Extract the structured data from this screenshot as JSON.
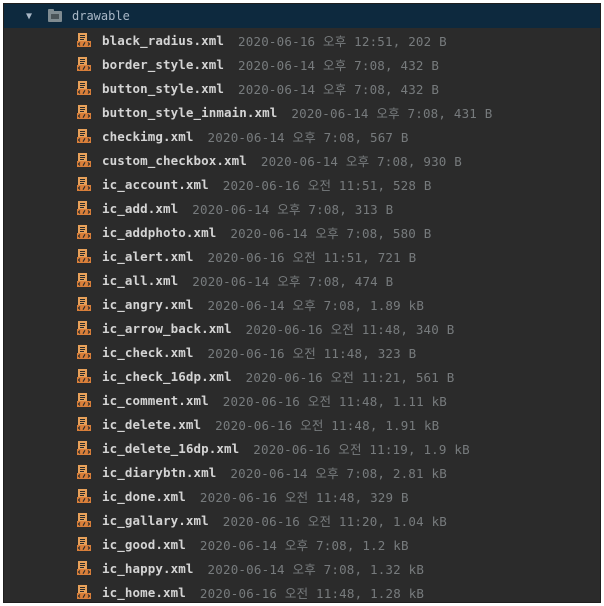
{
  "folder": {
    "name": "drawable",
    "expanded_arrow": "▼"
  },
  "icons": {
    "folder": "folder-icon",
    "file": "xml-file-icon",
    "file_color": "#e8a15a"
  },
  "files": [
    {
      "name": "black_radius.xml",
      "meta": "2020-06-16 오후 12:51, 202 B"
    },
    {
      "name": "border_style.xml",
      "meta": "2020-06-14 오후 7:08, 432 B"
    },
    {
      "name": "button_style.xml",
      "meta": "2020-06-14 오후 7:08, 432 B"
    },
    {
      "name": "button_style_inmain.xml",
      "meta": "2020-06-14 오후 7:08, 431 B"
    },
    {
      "name": "checkimg.xml",
      "meta": "2020-06-14 오후 7:08, 567 B"
    },
    {
      "name": "custom_checkbox.xml",
      "meta": "2020-06-14 오후 7:08, 930 B"
    },
    {
      "name": "ic_account.xml",
      "meta": "2020-06-16 오전 11:51, 528 B"
    },
    {
      "name": "ic_add.xml",
      "meta": "2020-06-14 오후 7:08, 313 B"
    },
    {
      "name": "ic_addphoto.xml",
      "meta": "2020-06-14 오후 7:08, 580 B"
    },
    {
      "name": "ic_alert.xml",
      "meta": "2020-06-16 오전 11:51, 721 B"
    },
    {
      "name": "ic_all.xml",
      "meta": "2020-06-14 오후 7:08, 474 B"
    },
    {
      "name": "ic_angry.xml",
      "meta": "2020-06-14 오후 7:08, 1.89 kB"
    },
    {
      "name": "ic_arrow_back.xml",
      "meta": "2020-06-16 오전 11:48, 340 B"
    },
    {
      "name": "ic_check.xml",
      "meta": "2020-06-16 오전 11:48, 323 B"
    },
    {
      "name": "ic_check_16dp.xml",
      "meta": "2020-06-16 오전 11:21, 561 B"
    },
    {
      "name": "ic_comment.xml",
      "meta": "2020-06-16 오전 11:48, 1.11 kB"
    },
    {
      "name": "ic_delete.xml",
      "meta": "2020-06-16 오전 11:48, 1.91 kB"
    },
    {
      "name": "ic_delete_16dp.xml",
      "meta": "2020-06-16 오전 11:19, 1.9 kB"
    },
    {
      "name": "ic_diarybtn.xml",
      "meta": "2020-06-14 오후 7:08, 2.81 kB"
    },
    {
      "name": "ic_done.xml",
      "meta": "2020-06-16 오전 11:48, 329 B"
    },
    {
      "name": "ic_gallary.xml",
      "meta": "2020-06-16 오전 11:20, 1.04 kB"
    },
    {
      "name": "ic_good.xml",
      "meta": "2020-06-14 오후 7:08, 1.2 kB"
    },
    {
      "name": "ic_happy.xml",
      "meta": "2020-06-14 오후 7:08, 1.32 kB"
    },
    {
      "name": "ic_home.xml",
      "meta": "2020-06-16 오전 11:48, 1.28 kB"
    }
  ]
}
